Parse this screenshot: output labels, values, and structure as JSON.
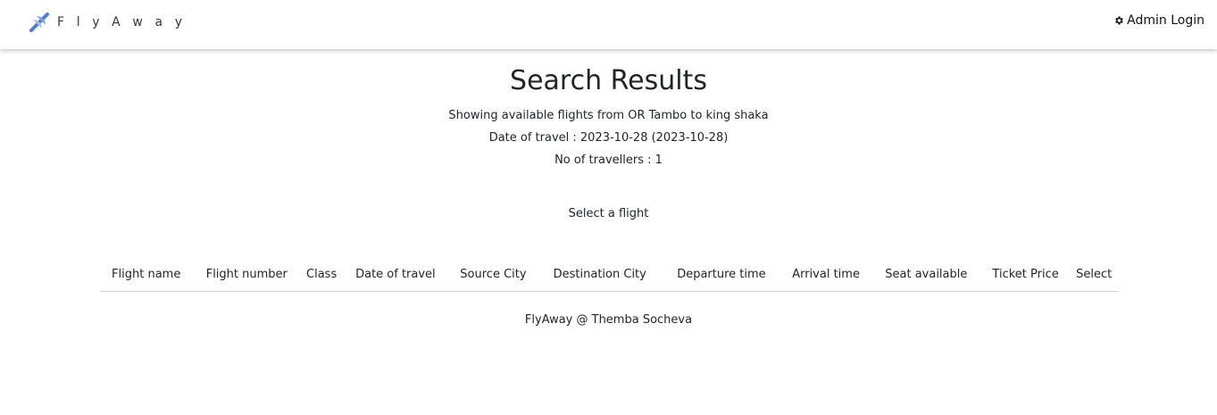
{
  "navbar": {
    "brand_text": "F l y A w a y",
    "brand_icon": "airplane-icon",
    "admin_login_label": "Admin Login",
    "admin_icon": "gear-icon"
  },
  "main": {
    "title": "Search Results",
    "route_line": "Showing available flights from OR Tambo to king shaka",
    "date_line": "Date of travel : 2023-10-28 (2023-10-28)",
    "travellers_line": "No of travellers : 1",
    "select_prompt": "Select a flight"
  },
  "table": {
    "columns": [
      "Flight name",
      "Flight number",
      "Class",
      "Date of travel",
      "Source City",
      "Destination City",
      "Departure time",
      "Arrival time",
      "Seat available",
      "Ticket Price",
      "Select"
    ],
    "rows": []
  },
  "footer": {
    "text": "FlyAway @ Themba Socheva"
  },
  "colors": {
    "brand_icon_blue": "#4a80d1",
    "brand_icon_light": "#a9c1e8",
    "text": "#212529",
    "table_border": "#cfd4d9"
  }
}
